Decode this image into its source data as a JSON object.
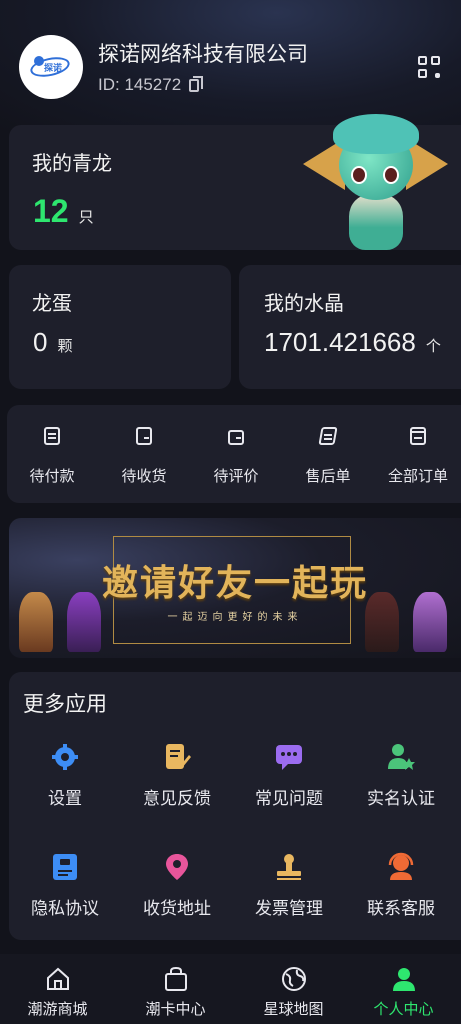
{
  "header": {
    "company": "探诺网络科技有限公司",
    "id_text": "ID: 145272",
    "logo_text": "探诺"
  },
  "dragon_card": {
    "title": "我的青龙",
    "count": "12",
    "unit": "只"
  },
  "egg_card": {
    "title": "龙蛋",
    "count": "0",
    "unit": "颗"
  },
  "crystal_card": {
    "title": "我的水晶",
    "count": "1701.421668",
    "unit": "个"
  },
  "orders": [
    {
      "label": "待付款",
      "icon": "clipboard-icon"
    },
    {
      "label": "待收货",
      "icon": "wallet-icon"
    },
    {
      "label": "待评价",
      "icon": "wallet-review-icon"
    },
    {
      "label": "售后单",
      "icon": "book-icon"
    },
    {
      "label": "全部订单",
      "icon": "receipt-icon"
    }
  ],
  "banner": {
    "title": "邀请好友一起玩",
    "subtitle": "一起迈向更好的未来"
  },
  "apps": {
    "title": "更多应用",
    "items": [
      {
        "label": "设置",
        "icon": "gear-icon",
        "color": "#3d8df5"
      },
      {
        "label": "意见反馈",
        "icon": "feedback-edit-icon",
        "color": "#e9b760"
      },
      {
        "label": "常见问题",
        "icon": "chat-bubble-icon",
        "color": "#9b6cf0"
      },
      {
        "label": "实名认证",
        "icon": "user-verified-icon",
        "color": "#4bc47a"
      },
      {
        "label": "隐私协议",
        "icon": "document-icon",
        "color": "#3d8df5"
      },
      {
        "label": "收货地址",
        "icon": "location-pin-icon",
        "color": "#e8559b"
      },
      {
        "label": "发票管理",
        "icon": "stamp-icon",
        "color": "#e9b760"
      },
      {
        "label": "联系客服",
        "icon": "headset-icon",
        "color": "#f06a35"
      }
    ]
  },
  "tabs": [
    {
      "label": "潮游商城",
      "icon": "home-icon"
    },
    {
      "label": "潮卡中心",
      "icon": "shopping-bag-icon"
    },
    {
      "label": "星球地图",
      "icon": "globe-icon"
    },
    {
      "label": "个人中心",
      "icon": "user-icon",
      "active": true
    }
  ],
  "colors": {
    "accent": "#2ee66f",
    "card": "#1e1f2b",
    "background": "#12131b"
  }
}
